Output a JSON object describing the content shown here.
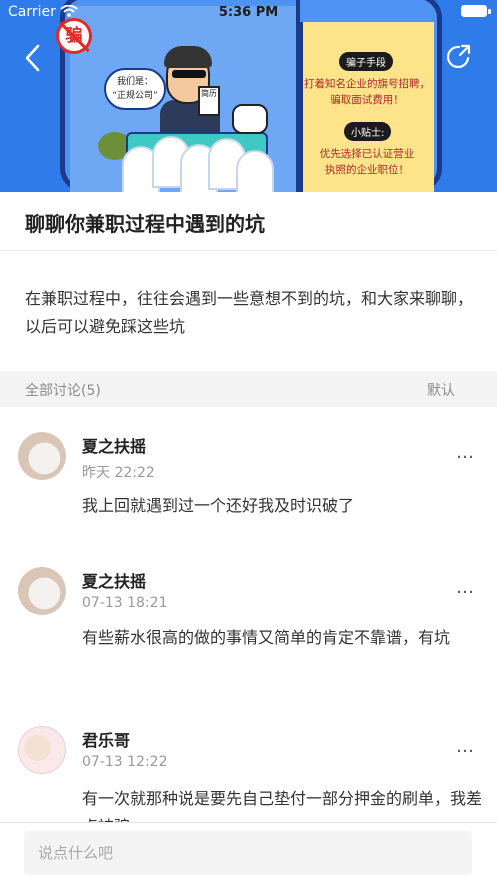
{
  "status_bar": {
    "carrier": "Carrier",
    "time": "5:36 PM"
  },
  "banner": {
    "badge_text": "骗",
    "speech_bubble": "我们是：“正规公司”",
    "speech_line1": "我们是：",
    "speech_line2": "“正规公司”",
    "resume_label": "简历",
    "tag1": "骗子手段",
    "tip1_line1": "打着知名企业的旗号招聘，",
    "tip1_line2": "骗取面试费用！",
    "tag2": "小贴士:",
    "tip2_line1": "优先选择已认证营业",
    "tip2_line2": "执照的企业职位！"
  },
  "topic": {
    "title": "聊聊你兼职过程中遇到的坑",
    "description": "在兼职过程中，往往会遇到一些意想不到的坑，和大家来聊聊，以后可以避免踩这些坑"
  },
  "discussion": {
    "count_label": "全部讨论(5)",
    "sort_label": "默认",
    "more_icon": "…",
    "comments": [
      {
        "name": "夏之扶摇",
        "time": "昨天 22:22",
        "body": "我上回就遇到过一个还好我及时识破了"
      },
      {
        "name": "夏之扶摇",
        "time": "07-13 18:21",
        "body": "有些薪水很高的做的事情又简单的肯定不靠谱，有坑"
      },
      {
        "name": "君乐哥",
        "time": "07-13 12:22",
        "body": "有一次就那种说是要先自己垫付一部分押金的刷单，我差点被骗"
      }
    ]
  },
  "composer": {
    "placeholder": "说点什么吧",
    "value": ""
  },
  "colors": {
    "banner_blue": "#2f7bea",
    "accent_red": "#e12b2b"
  },
  "icons": [
    "back-arrow-icon",
    "share-icon",
    "more-icon",
    "wifi-icon",
    "battery-icon"
  ]
}
